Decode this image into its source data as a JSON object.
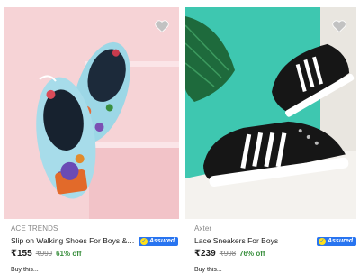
{
  "products": [
    {
      "brand": "ACE TRENDS",
      "title": "Slip on Walking Shoes For Boys & ...",
      "assured_label": "Assured",
      "price": "₹155",
      "mrp": "₹999",
      "discount": "61% off",
      "image_icon": "slip-on-shoes-image",
      "next_line": "Buy this..."
    },
    {
      "brand": "Axter",
      "title": "Lace Sneakers For Boys",
      "assured_label": "Assured",
      "price": "₹239",
      "mrp": "₹998",
      "discount": "76% off",
      "image_icon": "lace-sneakers-image",
      "next_line": "Buy this..."
    }
  ],
  "colors": {
    "assured_blue": "#2874f0",
    "discount_green": "#388e3c",
    "wishlist_grey": "#c2c2c2"
  }
}
